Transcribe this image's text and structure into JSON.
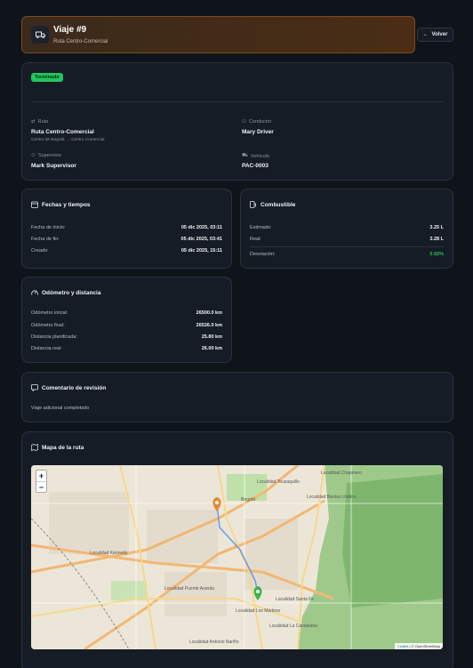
{
  "header": {
    "title": "Viaje #9",
    "subtitle": "Ruta Centro-Comercial",
    "back_label": "Volver"
  },
  "summary": {
    "status": "Terminado",
    "route_label": "Ruta",
    "route_value": "Ruta Centro-Comercial",
    "route_detail": "Centro de Bogotá → Centro Comercial",
    "driver_label": "Conductor",
    "driver_value": "Mary Driver",
    "supervisor_label": "Supervisor",
    "supervisor_value": "Mark Supervisor",
    "vehicle_label": "Vehículo",
    "vehicle_value": "PAC-0003"
  },
  "dates": {
    "title": "Fechas y tiempos",
    "rows": [
      {
        "label": "Fecha de inicio:",
        "value": "05 dic 2025, 03:11"
      },
      {
        "label": "Fecha de fin:",
        "value": "05 dic 2025, 03:41"
      },
      {
        "label": "Creado:",
        "value": "05 dic 2025, 15:11"
      }
    ]
  },
  "fuel": {
    "title": "Combustible",
    "rows": [
      {
        "label": "Estimado:",
        "value": "3.25 L"
      },
      {
        "label": "Real:",
        "value": "3.28 L"
      },
      {
        "label": "Desviación:",
        "value": "0.92%"
      }
    ]
  },
  "odometer": {
    "title": "Odómetro y distancia",
    "rows": [
      {
        "label": "Odómetro inicial:",
        "value": "26500.0 km"
      },
      {
        "label": "Odómetro final:",
        "value": "26526.0 km"
      },
      {
        "label": "Distancia planificada:",
        "value": "25.80 km"
      },
      {
        "label": "Distancia real:",
        "value": "26.00 km"
      }
    ]
  },
  "review": {
    "title": "Comentario de revisión",
    "text": "Viaje adicional completado"
  },
  "map": {
    "title": "Mapa de la ruta",
    "zoom_in": "+",
    "zoom_out": "−",
    "attribution_leaflet": "Leaflet",
    "attribution_osm": "| © OpenStreetMap",
    "places": [
      {
        "name": "Localidad Teusaquillo"
      },
      {
        "name": "Localidad Barrios Unidos"
      },
      {
        "name": "Bogotá"
      },
      {
        "name": "Localidad Chapinero"
      },
      {
        "name": "Localidad Kennedy"
      },
      {
        "name": "Localidad Puente Aranda"
      },
      {
        "name": "Localidad Los Mártires"
      },
      {
        "name": "Localidad Santa Fe"
      },
      {
        "name": "Localidad La Candelaria"
      },
      {
        "name": "Localidad Antonio Nariño"
      }
    ],
    "marker_start_color": "#e28a2b",
    "marker_end_color": "#3bb54a"
  }
}
